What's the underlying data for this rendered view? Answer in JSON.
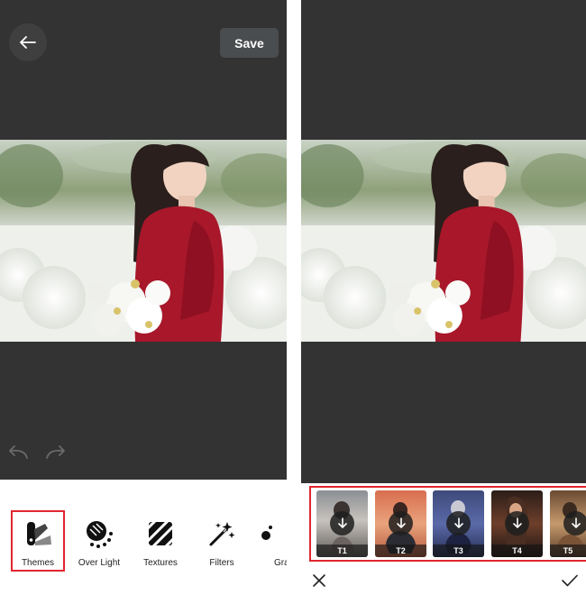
{
  "left": {
    "save_label": "Save",
    "tools": [
      {
        "label": "Themes",
        "icon": "themes-icon"
      },
      {
        "label": "Over Light",
        "icon": "over-light-icon"
      },
      {
        "label": "Textures",
        "icon": "textures-icon"
      },
      {
        "label": "Filters",
        "icon": "filters-icon"
      },
      {
        "label": "Gra",
        "icon": "gradient-icon"
      }
    ],
    "selected_tool": "Themes"
  },
  "right": {
    "themes": [
      {
        "label": "T1"
      },
      {
        "label": "T2"
      },
      {
        "label": "T3"
      },
      {
        "label": "T4"
      },
      {
        "label": "T5"
      }
    ]
  },
  "colors": {
    "background_dark": "#333333",
    "highlight_red": "#e0262e",
    "save_button": "#4a4d4f"
  }
}
